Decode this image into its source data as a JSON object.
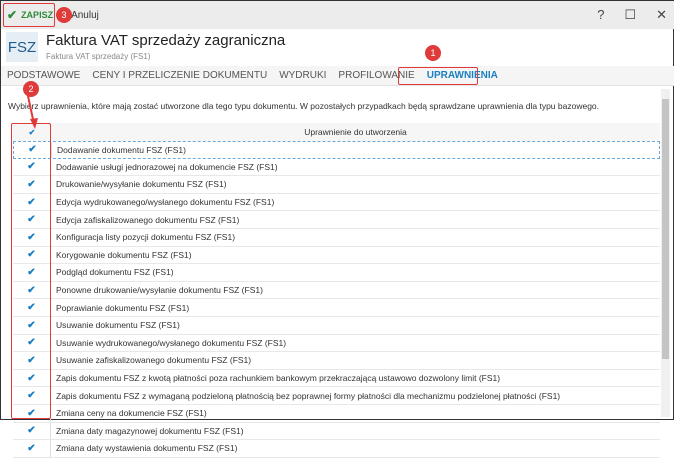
{
  "toolbar": {
    "save_label": "ZAPISZ",
    "cancel_label": "Anuluj",
    "help": "?",
    "maximize": "☐",
    "close": "✕"
  },
  "header": {
    "logo": "FSZ",
    "title": "Faktura VAT sprzedaży zagraniczna",
    "subtitle": "Faktura VAT sprzedaży (FS1)"
  },
  "tabs": [
    "PODSTAWOWE",
    "CENY I PRZELICZENIE DOKUMENTU",
    "WYDRUKI",
    "PROFILOWANIE",
    "UPRAWNIENIA"
  ],
  "description": "Wybierz uprawnienia, które mają zostać utworzone dla tego typu dokumentu. W pozostałych przypadkach będą sprawdzane uprawnienia dla typu bazowego.",
  "grid": {
    "column_header": "Uprawnienie do utworzenia",
    "rows": [
      "Dodawanie dokumentu FSZ (FS1)",
      "Dodawanie usługi jednorazowej na dokumencie FSZ (FS1)",
      "Drukowanie/wysyłanie dokumentu FSZ (FS1)",
      "Edycja wydrukowanego/wysłanego dokumentu FSZ (FS1)",
      "Edycja zafiskalizowanego dokumentu FSZ (FS1)",
      "Konfiguracja listy pozycji dokumentu FSZ (FS1)",
      "Korygowanie dokumentu FSZ (FS1)",
      "Podgląd dokumentu FSZ (FS1)",
      "Ponowne drukowanie/wysyłanie dokumentu FSZ (FS1)",
      "Poprawianie dokumentu FSZ (FS1)",
      "Usuwanie dokumentu FSZ (FS1)",
      "Usuwanie wydrukowanego/wysłanego dokumentu FSZ (FS1)",
      "Usuwanie zafiskalizowanego dokumentu FSZ (FS1)",
      "Zapis dokumentu FSZ z kwotą płatności poza rachunkiem bankowym przekraczającą ustawowo dozwolony limit (FS1)",
      "Zapis dokumentu FSZ z wymaganą podzieloną płatnością bez poprawnej formy płatności dla mechanizmu podzielonej płatności (FS1)",
      "Zmiana ceny na dokumencie FSZ (FS1)",
      "Zmiana daty magazynowej dokumentu FSZ (FS1)",
      "Zmiana daty wystawienia dokumentu FSZ (FS1)"
    ]
  },
  "annotations": [
    "1",
    "2",
    "3"
  ]
}
